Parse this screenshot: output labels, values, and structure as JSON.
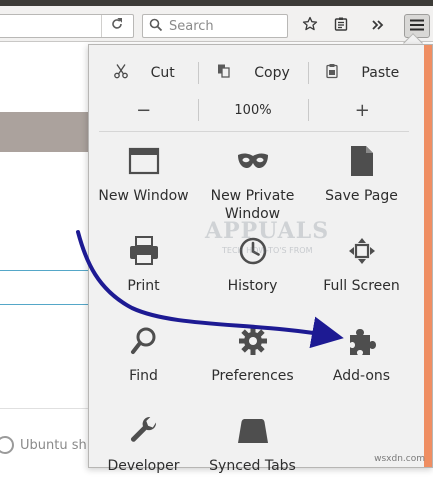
{
  "toolbar": {
    "search_placeholder": "Search",
    "icons": [
      "reload-icon",
      "search-icon",
      "bookmark-star-icon",
      "reader-icon",
      "overflow-icon",
      "hamburger-menu-icon"
    ]
  },
  "background_page": {
    "footer_text": "Ubuntu sh"
  },
  "menu": {
    "edit": {
      "cut": "Cut",
      "copy": "Copy",
      "paste": "Paste"
    },
    "zoom": {
      "minus": "−",
      "level": "100%",
      "plus": "+"
    },
    "items": {
      "new_window": "New Window",
      "new_private_window": "New Private Window",
      "save_page": "Save Page",
      "print": "Print",
      "history": "History",
      "full_screen": "Full Screen",
      "find": "Find",
      "preferences": "Preferences",
      "addons": "Add-ons",
      "developer": "Developer",
      "synced_tabs": "Synced Tabs"
    }
  },
  "overlay": {
    "watermark": "APPUALS",
    "watermark_sub": "TECH HOW-TO'S FROM",
    "credit": "wsxdn.com",
    "arrow_color": "#1d1a93",
    "accent_color": "#ef8e62"
  }
}
